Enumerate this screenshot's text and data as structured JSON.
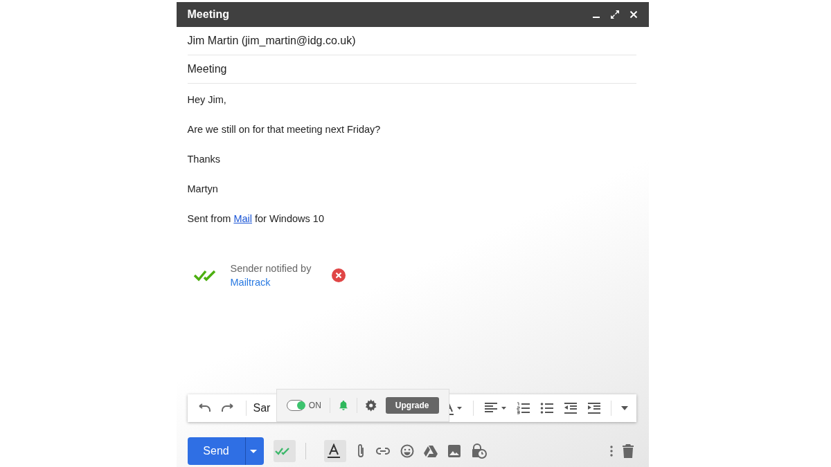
{
  "window": {
    "title": "Meeting"
  },
  "recipient": "Jim Martin (jim_martin@idg.co.uk)",
  "subject": "Meeting",
  "body": [
    {
      "kind": "text",
      "text": "Hey Jim,"
    },
    {
      "kind": "text",
      "text": "Are we still on for that meeting next Friday?"
    },
    {
      "kind": "text",
      "text": "Thanks"
    },
    {
      "kind": "text",
      "text": "Martyn"
    },
    {
      "kind": "link",
      "before": "Sent from ",
      "link": "Mail",
      "after": " for Windows 10"
    }
  ],
  "signature": {
    "text": "Sender notified by",
    "link": "Mailtrack"
  },
  "format_toolbar": {
    "font": "Sar"
  },
  "mailtrack_popup": {
    "toggle_on": true,
    "toggle_label": "ON",
    "upgrade": "Upgrade"
  },
  "bottom_bar": {
    "send": "Send",
    "mailtrack_active": true,
    "formatting_active": true
  }
}
